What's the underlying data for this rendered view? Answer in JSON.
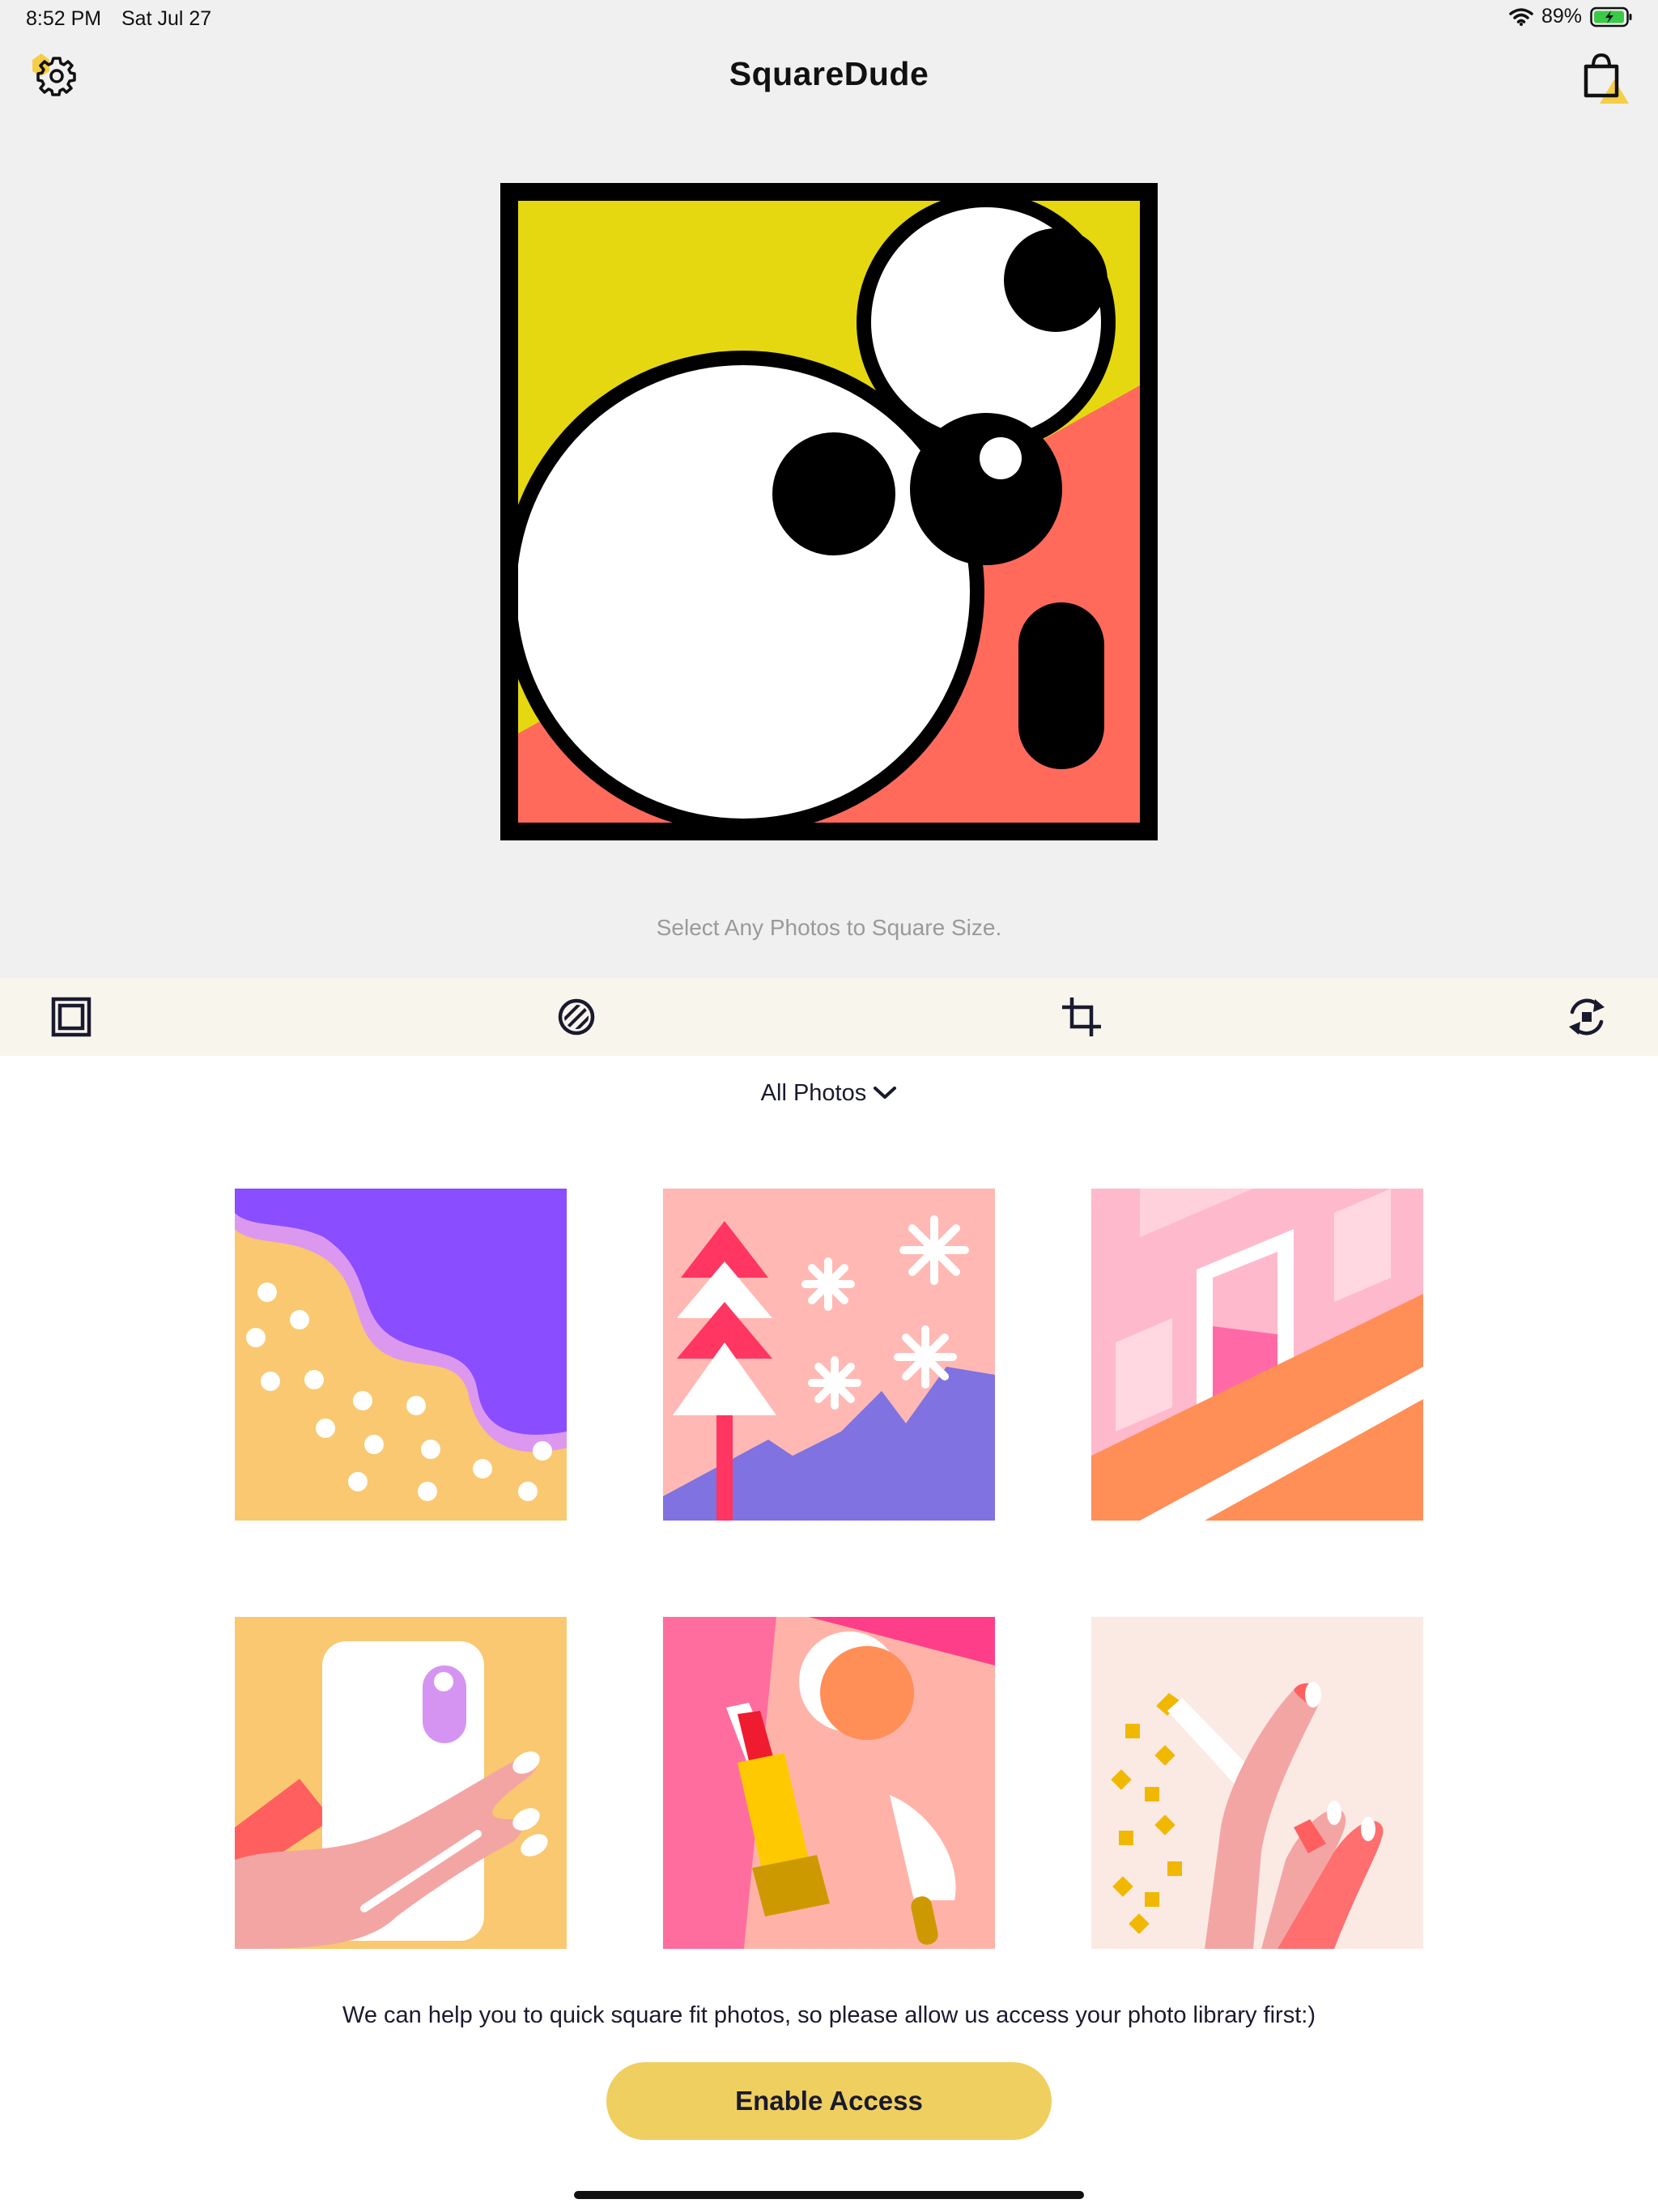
{
  "status_bar": {
    "time": "8:52 PM",
    "date": "Sat Jul 27",
    "battery": "89%",
    "wifi_icon": "wifi-icon",
    "battery_icon": "battery-charging-icon"
  },
  "header": {
    "title": "SquareDude",
    "settings_icon": "gear-icon",
    "store_icon": "shopping-bag-icon"
  },
  "hero": {
    "image": "squaredude-logo",
    "hint": "Select Any Photos to Square Size."
  },
  "toolbar": {
    "tools": [
      {
        "name": "frame",
        "icon": "square-frame-icon"
      },
      {
        "name": "pattern",
        "icon": "striped-circle-icon"
      },
      {
        "name": "crop",
        "icon": "crop-icon"
      },
      {
        "name": "rotate",
        "icon": "rotate-icon"
      }
    ]
  },
  "album": {
    "label": "All Photos",
    "icon": "chevron-down-icon"
  },
  "photos": [
    {
      "name": "wave-dots"
    },
    {
      "name": "winter-trees"
    },
    {
      "name": "window-stripes"
    },
    {
      "name": "hand-phone"
    },
    {
      "name": "lipstick-mirror"
    },
    {
      "name": "nail-polish"
    }
  ],
  "access": {
    "message": "We can help you to quick square fit photos, so please allow us access your photo library first:)",
    "button_label": "Enable Access"
  },
  "colors": {
    "accent_button": "#eecf60",
    "toolbar_bg": "#f8f5ed",
    "top_bg": "#f0f0f0",
    "logo_yellow": "#e6d810",
    "logo_red": "#ff6a5b"
  }
}
